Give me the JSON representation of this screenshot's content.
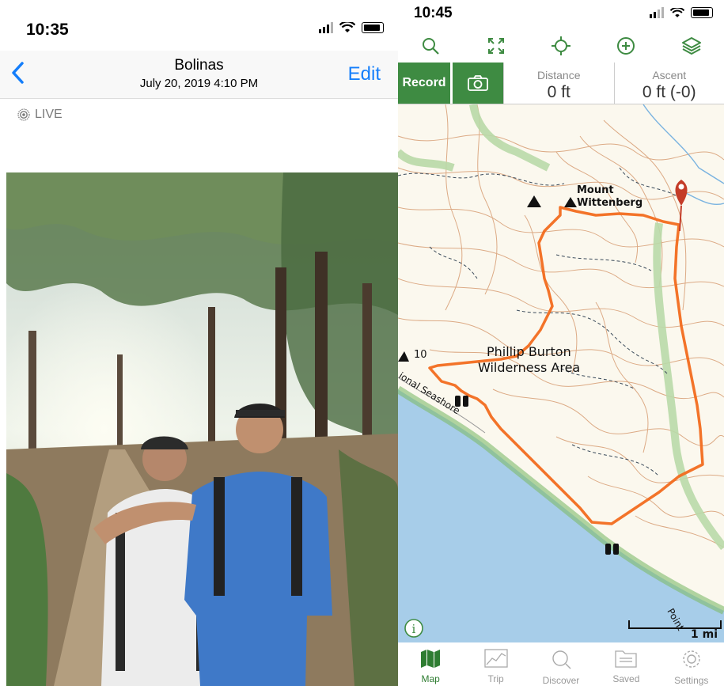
{
  "photos_app": {
    "status": {
      "time": "10:35"
    },
    "nav": {
      "back_icon": "chevron-left",
      "title": "Bolinas",
      "subtitle": "July 20, 2019  4:10 PM",
      "edit_label": "Edit"
    },
    "live_label": "LIVE"
  },
  "map_app": {
    "status": {
      "time": "10:45"
    },
    "toolbar": [
      "search-icon",
      "expand-icon",
      "locate-icon",
      "add-icon",
      "layers-icon"
    ],
    "record_label": "Record",
    "stats": {
      "distance": {
        "label": "Distance",
        "value": "0 ft"
      },
      "ascent": {
        "label": "Ascent",
        "value": "0 ft (-0)"
      }
    },
    "map_labels": {
      "mount": "Mount",
      "wittenberg": "Wittenberg",
      "wilderness_1": "Phillip Burton",
      "wilderness_2": "Wilderness Area",
      "seashore": "ional Seashore",
      "trail_num": "10",
      "point": "Point",
      "scale": "1 mi"
    },
    "colors": {
      "accent": "#3e8b42",
      "track": "#f26b1d",
      "water": "#a7cde9",
      "land": "#fbf8ee",
      "contour": "#d9a27a"
    },
    "tabs": [
      {
        "label": "Map",
        "active": true
      },
      {
        "label": "Trip"
      },
      {
        "label": "Discover"
      },
      {
        "label": "Saved"
      },
      {
        "label": "Settings"
      }
    ]
  }
}
